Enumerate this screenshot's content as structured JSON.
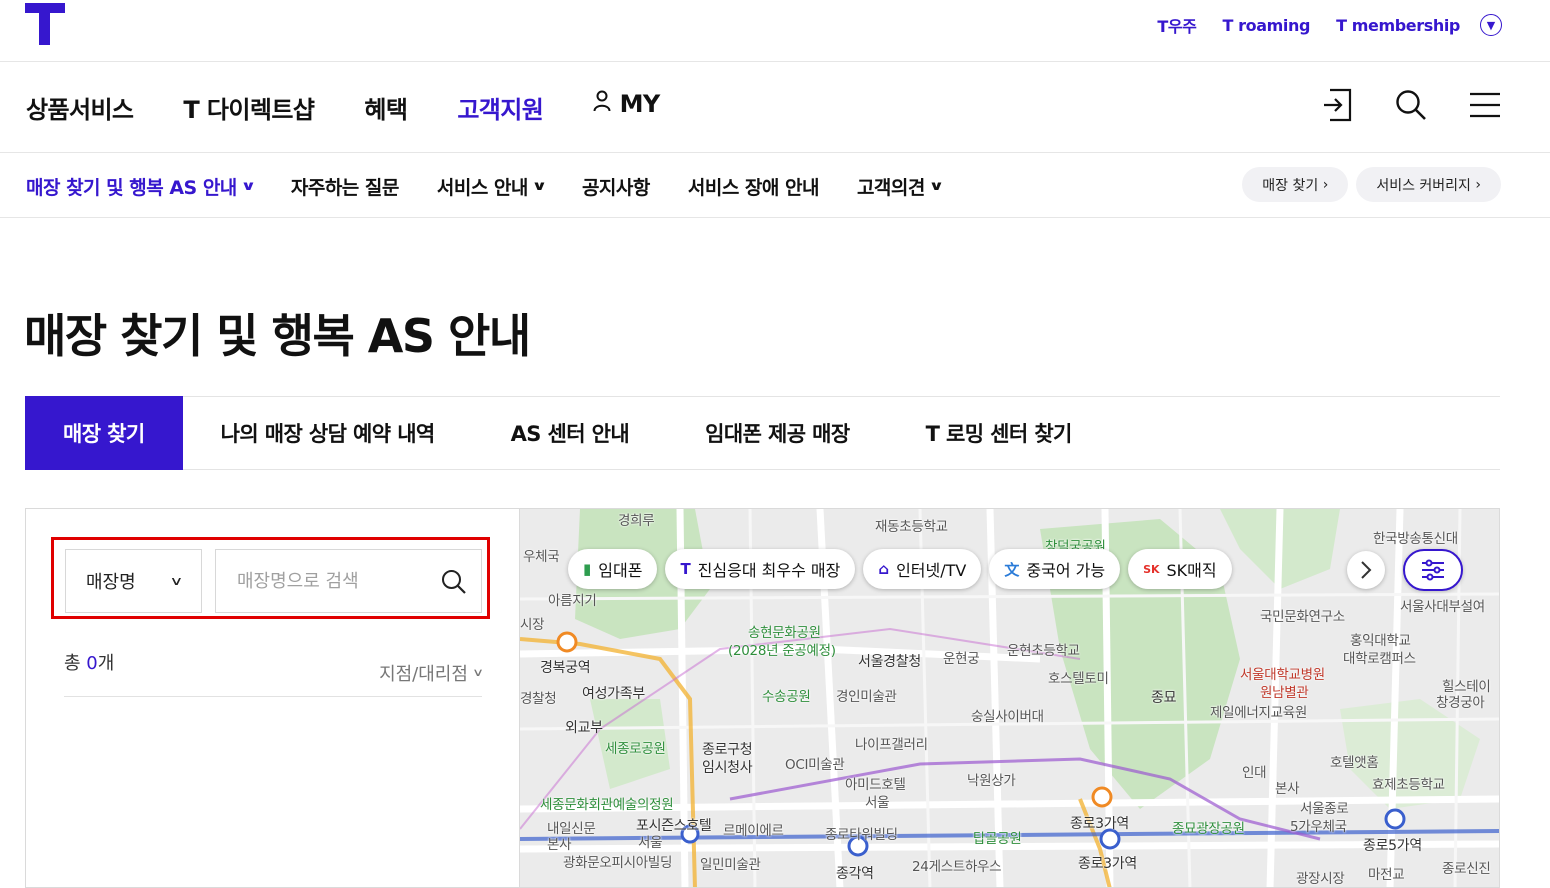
{
  "brand": {
    "color": "#3617CE",
    "logo": "T-logo"
  },
  "util_links": [
    "T우주",
    "T roaming",
    "T membership"
  ],
  "gnb": {
    "items": [
      "상품서비스",
      "T 다이렉트샵",
      "혜택",
      "고객지원",
      "MY"
    ],
    "active_index": 3,
    "icons": [
      "login-icon",
      "search-icon",
      "menu-icon"
    ]
  },
  "subnav": {
    "items": [
      "매장 찾기 및 행복 AS 안내",
      "자주하는 질문",
      "서비스 안내",
      "공지사항",
      "서비스 장애 안내",
      "고객의견"
    ],
    "pill_buttons": [
      "매장 찾기",
      "서비스 커버리지"
    ]
  },
  "page_title": "매장 찾기 및 행복 AS 안내",
  "tabs": {
    "items": [
      "매장 찾기",
      "나의 매장 상담 예약 내역",
      "AS 센터 안내",
      "임대폰 제공 매장",
      "T 로밍 센터 찾기"
    ],
    "active_index": 0
  },
  "search": {
    "select_value": "매장명",
    "placeholder": "매장명으로 검색",
    "value": ""
  },
  "results": {
    "count_prefix": "총 ",
    "count": "0",
    "count_suffix": "개",
    "filter_label": "지점/대리점"
  },
  "map": {
    "chips": [
      "임대폰",
      "진심응대 최우수 매장",
      "인터넷/TV",
      "중국어 가능",
      "SK매직"
    ],
    "labels": [
      "경희루",
      "재동초등학교",
      "창덕궁공원",
      "한국방송통신대",
      "우체국",
      "아름지기",
      "시장",
      "송현문화공원",
      "(2028년 준공예정)",
      "서울경찰청",
      "운현궁",
      "운현초등학교",
      "국민문화연구소",
      "홍익대학교",
      "대학로캠퍼스",
      "서울사대부설여",
      "경복궁역",
      "여성가족부",
      "수송공원",
      "경인미술관",
      "호스텔토미",
      "종묘",
      "서울대학교병원",
      "원남별관",
      "제일에너지교육원",
      "힐스테이",
      "창경궁아",
      "경찰청",
      "외교부",
      "세종로공원",
      "종로구청",
      "임시청사",
      "숭실사이버대",
      "나이프갤러리",
      "OCI미술관",
      "아미드호텔",
      "서울",
      "낙원상가",
      "호텔앳홈",
      "효제초등학교",
      "세종문화회관예술의정원",
      "내일신문",
      "본사",
      "포시즌스호텔",
      "서울",
      "종로타워빌딩",
      "탑골공원",
      "종로3가역",
      "종묘광장공원",
      "서울종로",
      "5가우체국",
      "종로5가역",
      "광화문오피시아빌딩",
      "일민미술관",
      "종각역",
      "24게스트하우스",
      "종로3가역",
      "마전교",
      "종로신진",
      "광장시장",
      "르메이에르",
      "인대",
      "본사"
    ]
  }
}
